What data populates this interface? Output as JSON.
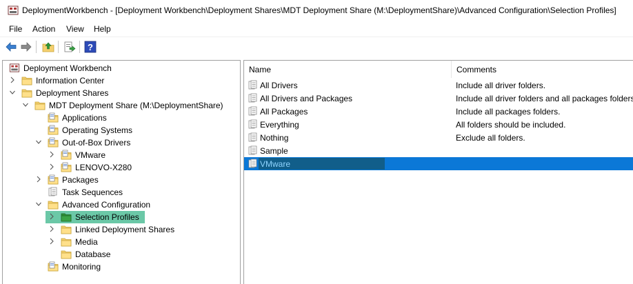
{
  "window": {
    "title": "DeploymentWorkbench - [Deployment Workbench\\Deployment Shares\\MDT Deployment Share (M:\\DeploymentShare)\\Advanced Configuration\\Selection Profiles]",
    "app_icon": "mdt-workbench-icon"
  },
  "menu": {
    "file": "File",
    "action": "Action",
    "view": "View",
    "help": "Help"
  },
  "toolbar": {
    "back_icon": "back-arrow-icon",
    "forward_icon": "forward-arrow-icon",
    "up_icon": "up-folder-icon",
    "export_icon": "export-list-icon",
    "help_icon": "help-icon"
  },
  "tree": {
    "root": "Deployment Workbench",
    "information_center": "Information Center",
    "deployment_shares": "Deployment Shares",
    "mdt_share": "MDT Deployment Share (M:\\DeploymentShare)",
    "applications": "Applications",
    "operating_systems": "Operating Systems",
    "out_of_box_drivers": "Out-of-Box Drivers",
    "vmware": "VMware",
    "lenovo": "LENOVO-X280",
    "packages": "Packages",
    "task_sequences": "Task Sequences",
    "advanced_configuration": "Advanced Configuration",
    "selection_profiles": "Selection Profiles",
    "linked_deployment_shares": "Linked Deployment Shares",
    "media": "Media",
    "database": "Database",
    "monitoring": "Monitoring"
  },
  "list": {
    "col_name": "Name",
    "col_comments": "Comments",
    "rows": [
      {
        "name": "All Drivers",
        "comment": "Include all driver folders."
      },
      {
        "name": "All Drivers and Packages",
        "comment": "Include all driver folders and all packages folders."
      },
      {
        "name": "All Packages",
        "comment": "Include all packages folders."
      },
      {
        "name": "Everything",
        "comment": "All folders should be included."
      },
      {
        "name": "Nothing",
        "comment": "Exclude all folders."
      },
      {
        "name": "Sample",
        "comment": ""
      },
      {
        "name": "VMware",
        "comment": ""
      }
    ]
  },
  "colors": {
    "tree_selection": "#6bc8a7",
    "list_selection": "#0b78d7",
    "rename_box": "#115e8a"
  }
}
